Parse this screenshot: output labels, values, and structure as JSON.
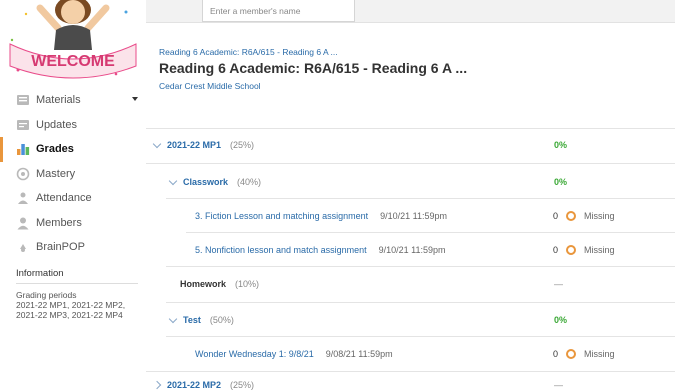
{
  "sidebar": {
    "items": [
      {
        "label": "Materials",
        "icon": "materials-icon",
        "has_dropdown": true,
        "active": false
      },
      {
        "label": "Updates",
        "icon": "updates-icon",
        "active": false
      },
      {
        "label": "Grades",
        "icon": "grades-icon",
        "active": true
      },
      {
        "label": "Mastery",
        "icon": "mastery-icon",
        "active": false
      },
      {
        "label": "Attendance",
        "icon": "attendance-icon",
        "active": false
      },
      {
        "label": "Members",
        "icon": "members-icon",
        "active": false
      },
      {
        "label": "BrainPOP",
        "icon": "brainpop-icon",
        "active": false
      }
    ],
    "information": {
      "heading": "Information",
      "grading_periods_label": "Grading periods",
      "grading_periods_value": "2021-22 MP1, 2021-22 MP2, 2021-22 MP3, 2021-22 MP4"
    }
  },
  "header": {
    "member_search_placeholder": "Enter a member's name",
    "breadcrumb": "Reading 6 Academic: R6A/615 - Reading 6 A ...",
    "title": "Reading 6 Academic: R6A/615 - Reading 6 A ...",
    "school": "Cedar Crest Middle School"
  },
  "grades": {
    "mp1": {
      "label": "2021-22 MP1",
      "weight": "(25%)",
      "grade": "0%"
    },
    "classwork": {
      "label": "Classwork",
      "weight": "(40%)",
      "grade": "0%"
    },
    "assignment1": {
      "title": "3. Fiction Lesson and matching assignment",
      "due": "9/10/21 11:59pm",
      "score": "0",
      "status": "Missing"
    },
    "assignment2": {
      "title": "5. Nonfiction lesson and match assignment",
      "due": "9/10/21 11:59pm",
      "score": "0",
      "status": "Missing"
    },
    "homework": {
      "label": "Homework",
      "weight": "(10%)",
      "grade": "—"
    },
    "test": {
      "label": "Test",
      "weight": "(50%)",
      "grade": "0%"
    },
    "assignment3": {
      "title": "Wonder Wednesday 1: 9/8/21",
      "due": "9/08/21 11:59pm",
      "score": "0",
      "status": "Missing"
    },
    "mp2": {
      "label": "2021-22 MP2",
      "weight": "(25%)",
      "grade": "—"
    }
  },
  "colors": {
    "accent": "#e9963c",
    "link": "#2a6ba8",
    "success": "#3aa835"
  }
}
